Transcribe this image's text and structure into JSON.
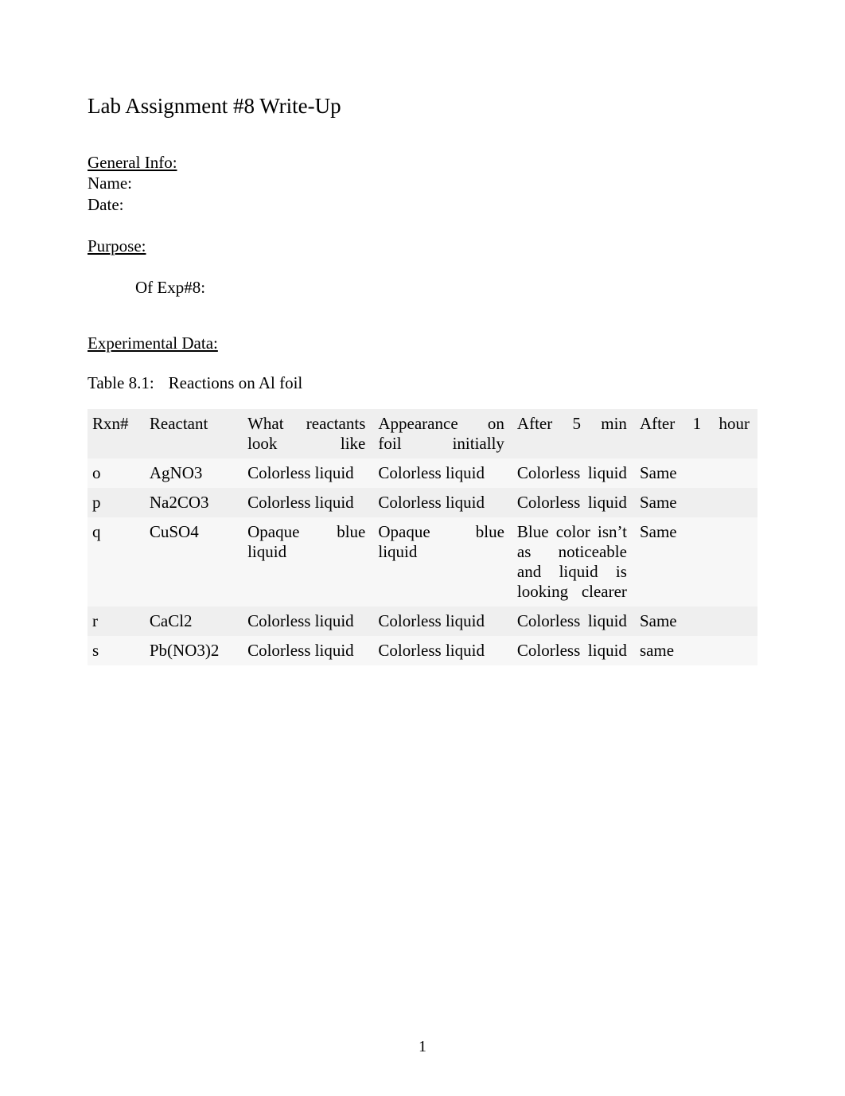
{
  "title": "Lab Assignment #8 Write-Up",
  "general_info_heading": "General Info:",
  "name_label": "Name:",
  "date_label": "Date:",
  "purpose_heading": "Purpose:",
  "purpose_sub": "Of Exp#8:",
  "experimental_data_heading": "Experimental Data:",
  "table_label_prefix": "Table 8.1:",
  "table_label_caption": "Reactions on Al foil",
  "columns": {
    "rxn": "Rxn#",
    "reactant": "Reactant",
    "looks": "What reactants look like",
    "initial": "Appearance on foil initially",
    "after5": "After 5 min",
    "after1h": "After 1 hour"
  },
  "rows": [
    {
      "rxn": "o",
      "reactant": "AgNO3",
      "looks": "Colorless liquid",
      "initial": "Colorless liquid",
      "after5": "Colorless liquid",
      "after1h": "Same"
    },
    {
      "rxn": "p",
      "reactant": "Na2CO3",
      "looks": "Colorless liquid",
      "initial": "Colorless liquid",
      "after5": "Colorless liquid",
      "after1h": "Same"
    },
    {
      "rxn": "q",
      "reactant": "CuSO4",
      "looks": "Opaque blue liquid",
      "initial": "Opaque blue liquid",
      "after5": "Blue color isn’t as noticeable and liquid is looking clearer",
      "after1h": "Same"
    },
    {
      "rxn": "r",
      "reactant": "CaCl2",
      "looks": "Colorless liquid",
      "initial": "Colorless liquid",
      "after5": "Colorless liquid",
      "after1h": "Same"
    },
    {
      "rxn": "s",
      "reactant": "Pb(NO3)2",
      "looks": "Colorless liquid",
      "initial": "Colorless liquid",
      "after5": "Colorless liquid",
      "after1h": "same"
    }
  ],
  "page_number": "1"
}
